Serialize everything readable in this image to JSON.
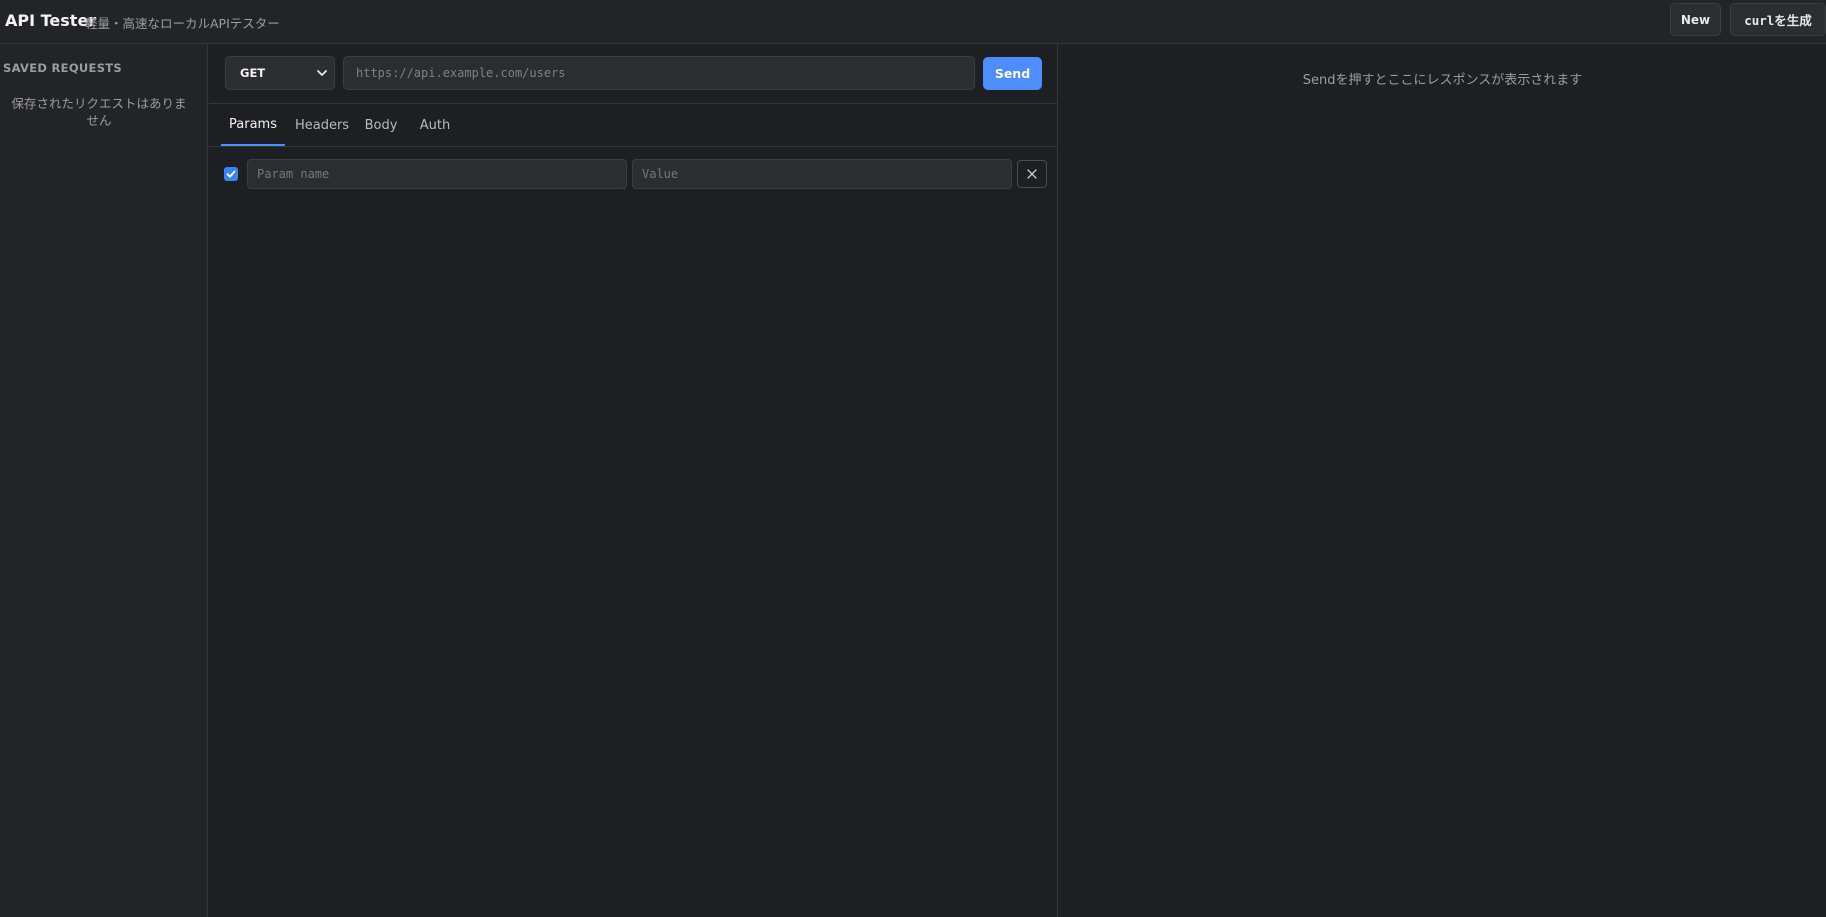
{
  "header": {
    "title": "API Tester",
    "subtitle": "軽量・高速なローカルAPIテスター",
    "new_label": "New",
    "curl_label": "curlを生成"
  },
  "sidebar": {
    "title": "SAVED REQUESTS",
    "empty_text": "保存されたリクエストはありません"
  },
  "request": {
    "method": "GET",
    "url_placeholder": "https://api.example.com/users",
    "send_label": "Send",
    "tabs": [
      {
        "label": "Params",
        "active": true
      },
      {
        "label": "Headers",
        "active": false
      },
      {
        "label": "Body",
        "active": false
      },
      {
        "label": "Auth",
        "active": false
      }
    ],
    "params": [
      {
        "enabled": true,
        "name_placeholder": "Param name",
        "value_placeholder": "Value"
      }
    ]
  },
  "response": {
    "empty_text": "Sendを押すとここにレスポンスが表示されます"
  },
  "colors": {
    "accent": "#4d8dff",
    "background": "#1e1f22",
    "panel": "#232427"
  }
}
